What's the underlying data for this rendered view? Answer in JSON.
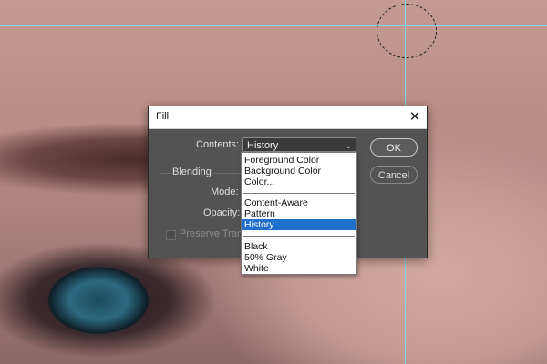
{
  "dialog": {
    "title": "Fill",
    "contents_label": "Contents:",
    "contents_value": "History",
    "blending_label": "Blending",
    "mode_label": "Mode:",
    "opacity_label": "Opacity:",
    "preserve_label": "Preserve Tran",
    "ok_label": "OK",
    "cancel_label": "Cancel",
    "close_symbol": "✕"
  },
  "dropdown": {
    "groups": [
      [
        "Foreground Color",
        "Background Color",
        "Color..."
      ],
      [
        "Content-Aware",
        "Pattern",
        "History"
      ],
      [
        "Black",
        "50% Gray",
        "White"
      ]
    ],
    "selected": "History"
  },
  "colors": {
    "guide": "#7fd8e8",
    "dialog_bg": "#535353",
    "selection": "#1e6fce"
  }
}
